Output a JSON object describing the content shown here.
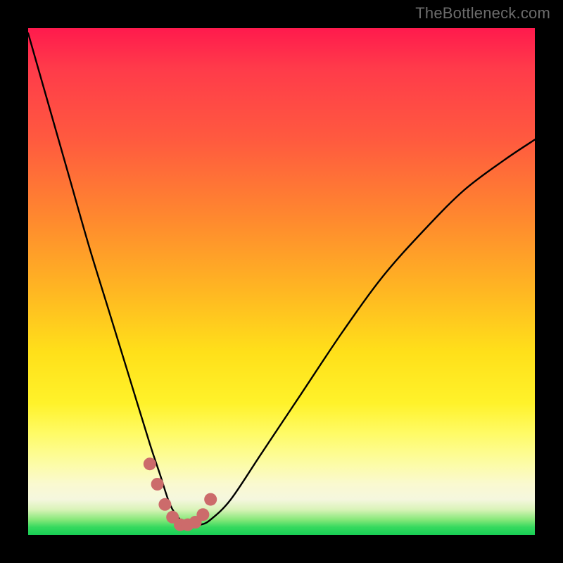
{
  "watermark": "TheBottleneck.com",
  "chart_data": {
    "type": "line",
    "title": "",
    "xlabel": "",
    "ylabel": "",
    "xlim": [
      0,
      100
    ],
    "ylim": [
      0,
      100
    ],
    "series": [
      {
        "name": "curve",
        "x": [
          0,
          4,
          8,
          12,
          16,
          20,
          24,
          26,
          28,
          30,
          32,
          34,
          36,
          40,
          46,
          54,
          62,
          70,
          78,
          86,
          94,
          100
        ],
        "values": [
          99,
          85,
          71,
          57,
          44,
          31,
          18,
          12,
          6,
          3,
          2,
          2,
          3,
          7,
          16,
          28,
          40,
          51,
          60,
          68,
          74,
          78
        ]
      },
      {
        "name": "dot-band",
        "x": [
          24,
          25.5,
          27,
          28.5,
          30,
          31.5,
          33,
          34.5,
          36
        ],
        "values": [
          14,
          10,
          6,
          3.5,
          2,
          2,
          2.5,
          4,
          7
        ]
      }
    ],
    "colors": {
      "curve": "#000000",
      "dots": "#cc6b6b"
    }
  }
}
